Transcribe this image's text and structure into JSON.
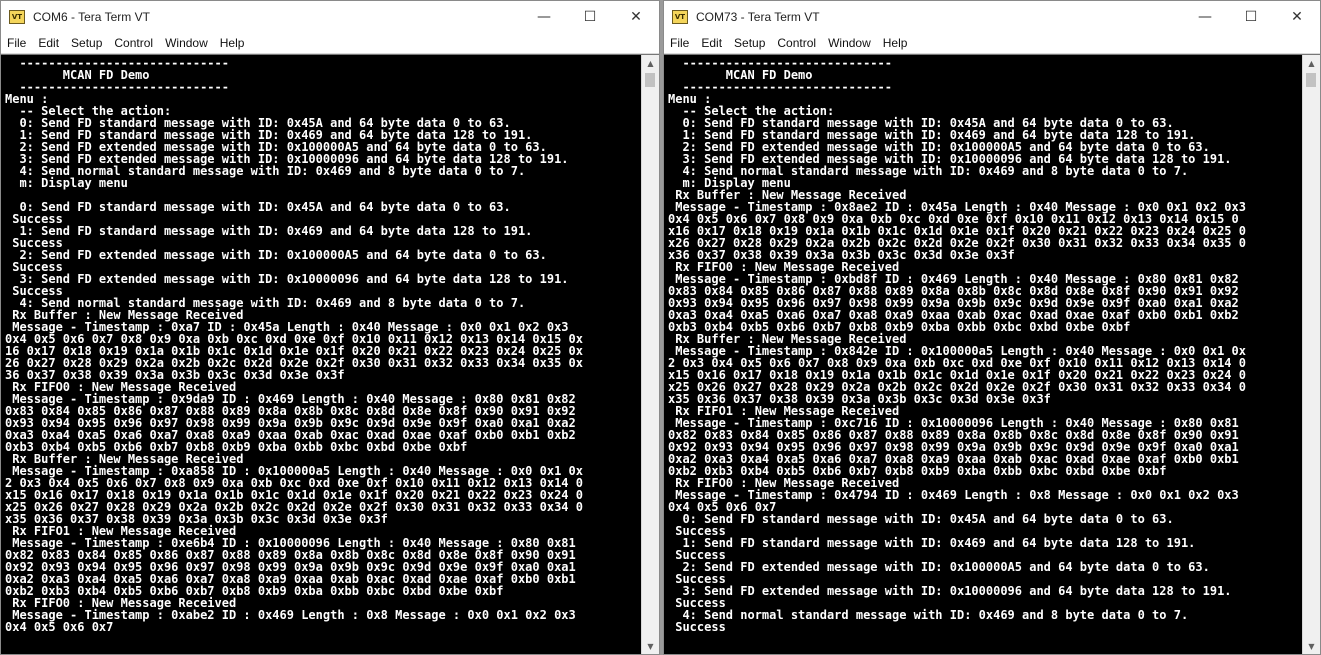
{
  "windows": [
    {
      "title": "COM6 - Tera Term VT",
      "icon": "tera-term-icon",
      "menu": [
        "File",
        "Edit",
        "Setup",
        "Control",
        "Window",
        "Help"
      ],
      "terminal_text": "  -----------------------------\n        MCAN FD Demo\n  -----------------------------\nMenu :\n  -- Select the action:\n  0: Send FD standard message with ID: 0x45A and 64 byte data 0 to 63.\n  1: Send FD standard message with ID: 0x469 and 64 byte data 128 to 191.\n  2: Send FD extended message with ID: 0x100000A5 and 64 byte data 0 to 63.\n  3: Send FD extended message with ID: 0x10000096 and 64 byte data 128 to 191.\n  4: Send normal standard message with ID: 0x469 and 8 byte data 0 to 7.\n  m: Display menu\n\n  0: Send FD standard message with ID: 0x45A and 64 byte data 0 to 63.\n Success\n  1: Send FD standard message with ID: 0x469 and 64 byte data 128 to 191.\n Success\n  2: Send FD extended message with ID: 0x100000A5 and 64 byte data 0 to 63.\n Success\n  3: Send FD extended message with ID: 0x10000096 and 64 byte data 128 to 191.\n Success\n  4: Send normal standard message with ID: 0x469 and 8 byte data 0 to 7.\n Rx Buffer : New Message Received\n Message - Timestamp : 0xa7 ID : 0x45a Length : 0x40 Message : 0x0 0x1 0x2 0x3\n0x4 0x5 0x6 0x7 0x8 0x9 0xa 0xb 0xc 0xd 0xe 0xf 0x10 0x11 0x12 0x13 0x14 0x15 0x\n16 0x17 0x18 0x19 0x1a 0x1b 0x1c 0x1d 0x1e 0x1f 0x20 0x21 0x22 0x23 0x24 0x25 0x\n26 0x27 0x28 0x29 0x2a 0x2b 0x2c 0x2d 0x2e 0x2f 0x30 0x31 0x32 0x33 0x34 0x35 0x\n36 0x37 0x38 0x39 0x3a 0x3b 0x3c 0x3d 0x3e 0x3f\n Rx FIFO0 : New Message Received\n Message - Timestamp : 0x9da9 ID : 0x469 Length : 0x40 Message : 0x80 0x81 0x82\n0x83 0x84 0x85 0x86 0x87 0x88 0x89 0x8a 0x8b 0x8c 0x8d 0x8e 0x8f 0x90 0x91 0x92\n0x93 0x94 0x95 0x96 0x97 0x98 0x99 0x9a 0x9b 0x9c 0x9d 0x9e 0x9f 0xa0 0xa1 0xa2\n0xa3 0xa4 0xa5 0xa6 0xa7 0xa8 0xa9 0xaa 0xab 0xac 0xad 0xae 0xaf 0xb0 0xb1 0xb2\n0xb3 0xb4 0xb5 0xb6 0xb7 0xb8 0xb9 0xba 0xbb 0xbc 0xbd 0xbe 0xbf\n Rx Buffer : New Message Received\n Message - Timestamp : 0xa858 ID : 0x100000a5 Length : 0x40 Message : 0x0 0x1 0x\n2 0x3 0x4 0x5 0x6 0x7 0x8 0x9 0xa 0xb 0xc 0xd 0xe 0xf 0x10 0x11 0x12 0x13 0x14 0\nx15 0x16 0x17 0x18 0x19 0x1a 0x1b 0x1c 0x1d 0x1e 0x1f 0x20 0x21 0x22 0x23 0x24 0\nx25 0x26 0x27 0x28 0x29 0x2a 0x2b 0x2c 0x2d 0x2e 0x2f 0x30 0x31 0x32 0x33 0x34 0\nx35 0x36 0x37 0x38 0x39 0x3a 0x3b 0x3c 0x3d 0x3e 0x3f\n Rx FIFO1 : New Message Received\n Message - Timestamp : 0xe6b4 ID : 0x10000096 Length : 0x40 Message : 0x80 0x81\n0x82 0x83 0x84 0x85 0x86 0x87 0x88 0x89 0x8a 0x8b 0x8c 0x8d 0x8e 0x8f 0x90 0x91\n0x92 0x93 0x94 0x95 0x96 0x97 0x98 0x99 0x9a 0x9b 0x9c 0x9d 0x9e 0x9f 0xa0 0xa1\n0xa2 0xa3 0xa4 0xa5 0xa6 0xa7 0xa8 0xa9 0xaa 0xab 0xac 0xad 0xae 0xaf 0xb0 0xb1\n0xb2 0xb3 0xb4 0xb5 0xb6 0xb7 0xb8 0xb9 0xba 0xbb 0xbc 0xbd 0xbe 0xbf\n Rx FIFO0 : New Message Received\n Message - Timestamp : 0xabe2 ID : 0x469 Length : 0x8 Message : 0x0 0x1 0x2 0x3\n0x4 0x5 0x6 0x7"
    },
    {
      "title": "COM73 - Tera Term VT",
      "icon": "tera-term-icon",
      "menu": [
        "File",
        "Edit",
        "Setup",
        "Control",
        "Window",
        "Help"
      ],
      "terminal_text": "  -----------------------------\n        MCAN FD Demo\n  -----------------------------\nMenu :\n  -- Select the action:\n  0: Send FD standard message with ID: 0x45A and 64 byte data 0 to 63.\n  1: Send FD standard message with ID: 0x469 and 64 byte data 128 to 191.\n  2: Send FD extended message with ID: 0x100000A5 and 64 byte data 0 to 63.\n  3: Send FD extended message with ID: 0x10000096 and 64 byte data 128 to 191.\n  4: Send normal standard message with ID: 0x469 and 8 byte data 0 to 7.\n  m: Display menu\n Rx Buffer : New Message Received\n Message - Timestamp : 0x8ae2 ID : 0x45a Length : 0x40 Message : 0x0 0x1 0x2 0x3\n0x4 0x5 0x6 0x7 0x8 0x9 0xa 0xb 0xc 0xd 0xe 0xf 0x10 0x11 0x12 0x13 0x14 0x15 0\nx16 0x17 0x18 0x19 0x1a 0x1b 0x1c 0x1d 0x1e 0x1f 0x20 0x21 0x22 0x23 0x24 0x25 0\nx26 0x27 0x28 0x29 0x2a 0x2b 0x2c 0x2d 0x2e 0x2f 0x30 0x31 0x32 0x33 0x34 0x35 0\nx36 0x37 0x38 0x39 0x3a 0x3b 0x3c 0x3d 0x3e 0x3f\n Rx FIFO0 : New Message Received\n Message - Timestamp : 0xbd8f ID : 0x469 Length : 0x40 Message : 0x80 0x81 0x82\n0x83 0x84 0x85 0x86 0x87 0x88 0x89 0x8a 0x8b 0x8c 0x8d 0x8e 0x8f 0x90 0x91 0x92\n0x93 0x94 0x95 0x96 0x97 0x98 0x99 0x9a 0x9b 0x9c 0x9d 0x9e 0x9f 0xa0 0xa1 0xa2\n0xa3 0xa4 0xa5 0xa6 0xa7 0xa8 0xa9 0xaa 0xab 0xac 0xad 0xae 0xaf 0xb0 0xb1 0xb2\n0xb3 0xb4 0xb5 0xb6 0xb7 0xb8 0xb9 0xba 0xbb 0xbc 0xbd 0xbe 0xbf\n Rx Buffer : New Message Received\n Message - Timestamp : 0x842e ID : 0x100000a5 Length : 0x40 Message : 0x0 0x1 0x\n2 0x3 0x4 0x5 0x6 0x7 0x8 0x9 0xa 0xb 0xc 0xd 0xe 0xf 0x10 0x11 0x12 0x13 0x14 0\nx15 0x16 0x17 0x18 0x19 0x1a 0x1b 0x1c 0x1d 0x1e 0x1f 0x20 0x21 0x22 0x23 0x24 0\nx25 0x26 0x27 0x28 0x29 0x2a 0x2b 0x2c 0x2d 0x2e 0x2f 0x30 0x31 0x32 0x33 0x34 0\nx35 0x36 0x37 0x38 0x39 0x3a 0x3b 0x3c 0x3d 0x3e 0x3f\n Rx FIFO1 : New Message Received\n Message - Timestamp : 0xc716 ID : 0x10000096 Length : 0x40 Message : 0x80 0x81\n0x82 0x83 0x84 0x85 0x86 0x87 0x88 0x89 0x8a 0x8b 0x8c 0x8d 0x8e 0x8f 0x90 0x91\n0x92 0x93 0x94 0x95 0x96 0x97 0x98 0x99 0x9a 0x9b 0x9c 0x9d 0x9e 0x9f 0xa0 0xa1\n0xa2 0xa3 0xa4 0xa5 0xa6 0xa7 0xa8 0xa9 0xaa 0xab 0xac 0xad 0xae 0xaf 0xb0 0xb1\n0xb2 0xb3 0xb4 0xb5 0xb6 0xb7 0xb8 0xb9 0xba 0xbb 0xbc 0xbd 0xbe 0xbf\n Rx FIFO0 : New Message Received\n Message - Timestamp : 0x4794 ID : 0x469 Length : 0x8 Message : 0x0 0x1 0x2 0x3\n0x4 0x5 0x6 0x7\n  0: Send FD standard message with ID: 0x45A and 64 byte data 0 to 63.\n Success\n  1: Send FD standard message with ID: 0x469 and 64 byte data 128 to 191.\n Success\n  2: Send FD extended message with ID: 0x100000A5 and 64 byte data 0 to 63.\n Success\n  3: Send FD extended message with ID: 0x10000096 and 64 byte data 128 to 191.\n Success\n  4: Send normal standard message with ID: 0x469 and 8 byte data 0 to 7.\n Success"
    }
  ],
  "colors": {
    "terminal_bg": "#000000",
    "terminal_fg": "#ffffff",
    "titlebar_bg": "#ffffff"
  }
}
